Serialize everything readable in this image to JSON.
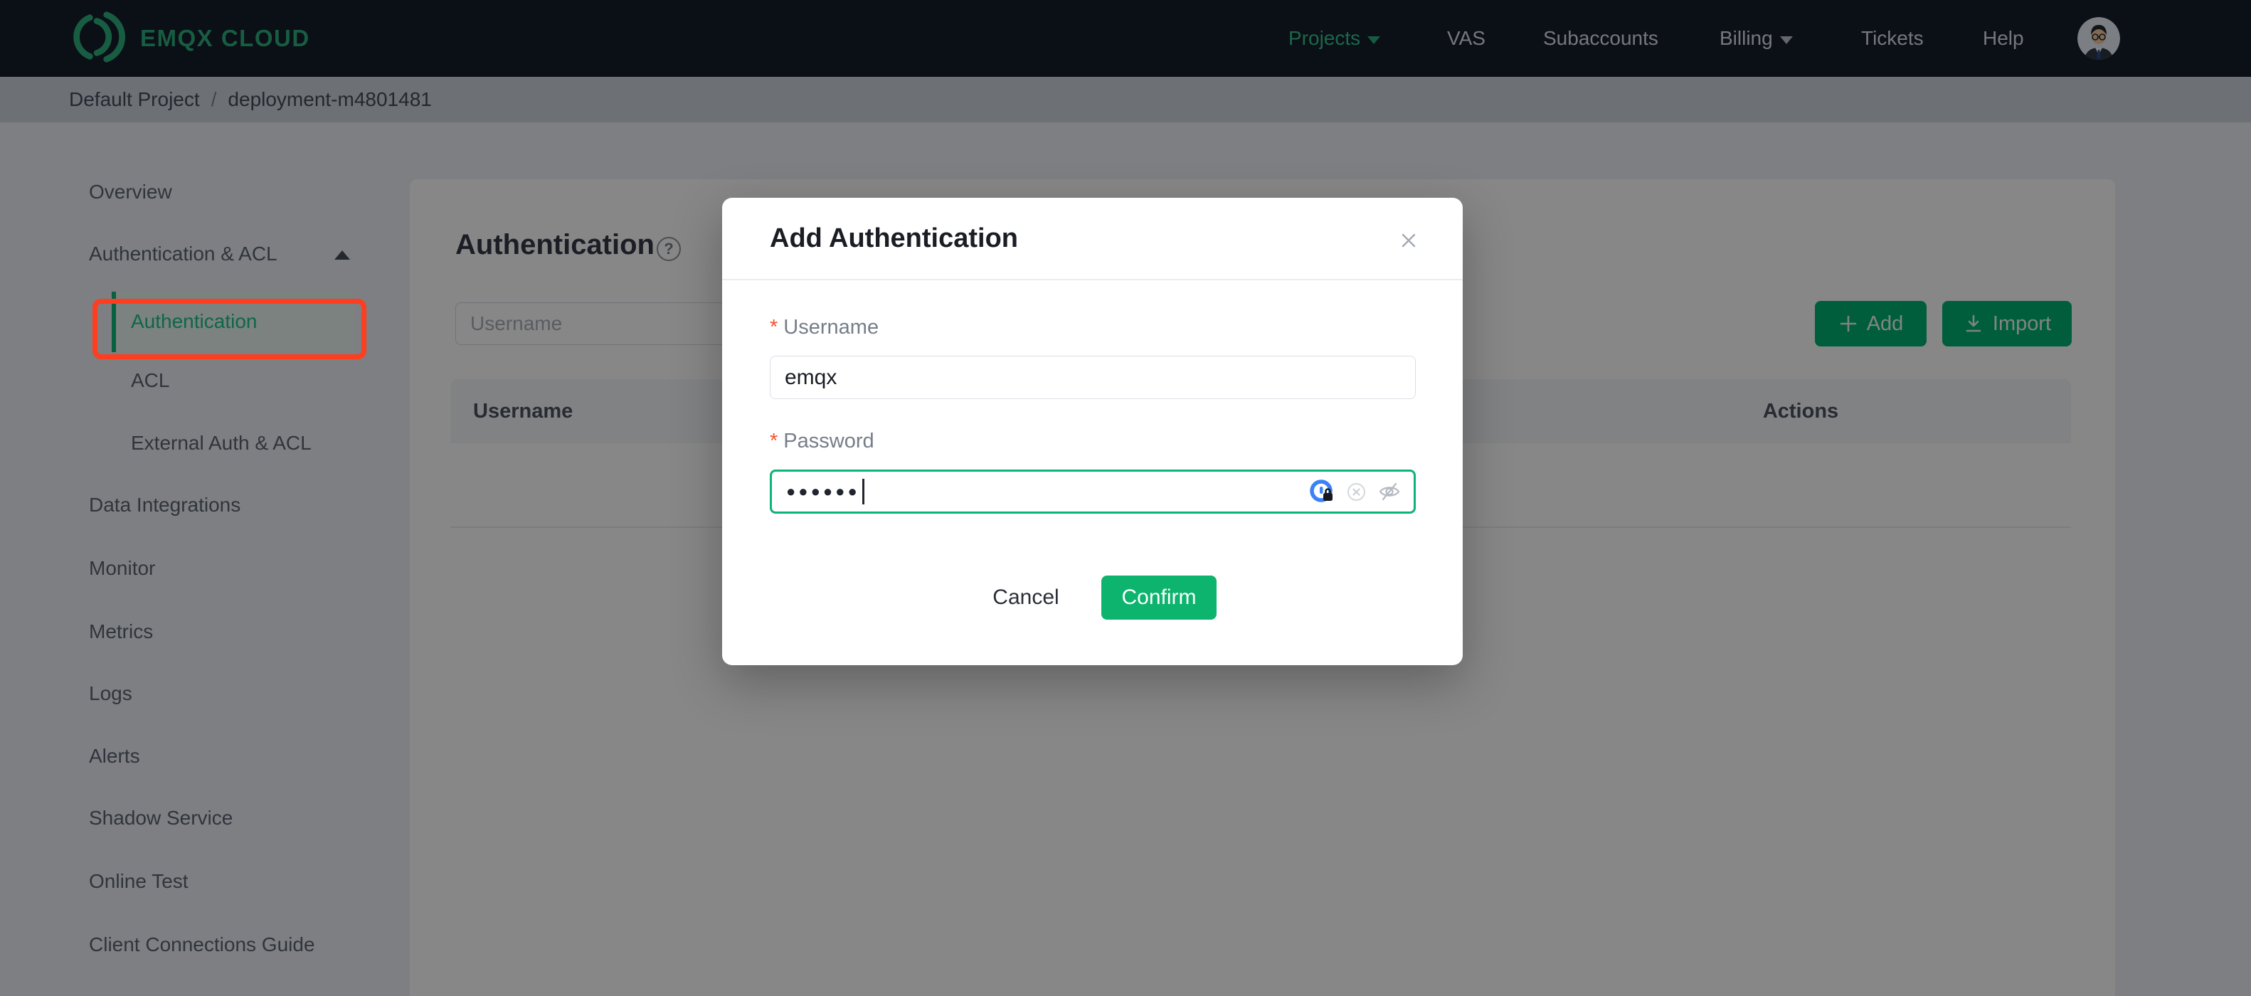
{
  "nav": {
    "brand": "EMQX CLOUD",
    "items": [
      {
        "label": "Projects"
      },
      {
        "label": "VAS"
      },
      {
        "label": "Subaccounts"
      },
      {
        "label": "Billing"
      },
      {
        "label": "Tickets"
      },
      {
        "label": "Help"
      }
    ]
  },
  "breadcrumb": {
    "project": "Default Project",
    "separator": "/",
    "deployment": "deployment-m4801481"
  },
  "sidebar": {
    "items": [
      {
        "label": "Overview"
      },
      {
        "label": "Authentication & ACL"
      },
      {
        "label": "Authentication"
      },
      {
        "label": "ACL"
      },
      {
        "label": "External Auth & ACL"
      },
      {
        "label": "Data Integrations"
      },
      {
        "label": "Monitor"
      },
      {
        "label": "Metrics"
      },
      {
        "label": "Logs"
      },
      {
        "label": "Alerts"
      },
      {
        "label": "Shadow Service"
      },
      {
        "label": "Online Test"
      },
      {
        "label": "Client Connections Guide"
      }
    ]
  },
  "main": {
    "title": "Authentication",
    "help_icon_char": "?",
    "search_placeholder": "Username",
    "add_label": "Add",
    "import_label": "Import",
    "table": {
      "columns": [
        "Username",
        "Actions"
      ],
      "rows": []
    }
  },
  "modal": {
    "title": "Add Authentication",
    "required_marker": "*",
    "username_label": "Username",
    "username_value": "emqx",
    "password_label": "Password",
    "password_masked": "●●●●●●",
    "cancel_label": "Cancel",
    "confirm_label": "Confirm"
  },
  "colors": {
    "accent_green": "#00b173",
    "confirm_green": "#0cb46e",
    "logo_green": "#2fae7d",
    "nav_background": "#161d2b",
    "annotation_red": "#ff3d1f",
    "password_focus_border": "#0eb377",
    "password_manager_blue": "#3b82f6"
  }
}
